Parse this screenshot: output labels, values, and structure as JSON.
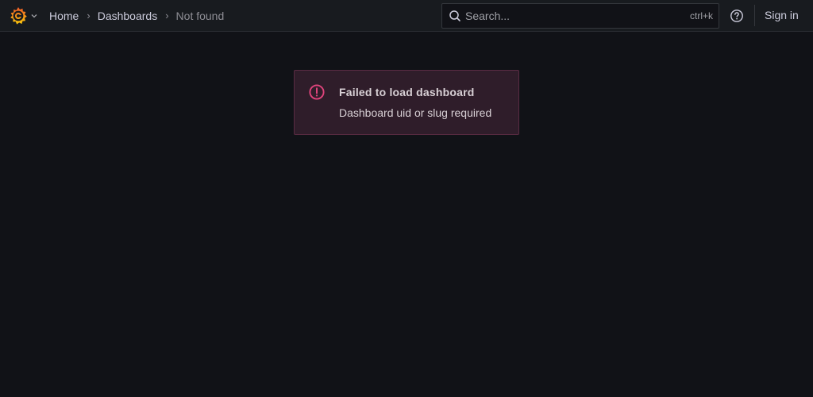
{
  "topbar": {
    "logo_icon": "grafana-logo-icon",
    "menu_chevron_icon": "chevron-down-icon",
    "breadcrumb": {
      "home": "Home",
      "dashboards": "Dashboards",
      "current": "Not found",
      "separator": "›"
    },
    "search": {
      "icon": "search-icon",
      "placeholder": "Search...",
      "shortcut": "ctrl+k"
    },
    "help_icon": "help-circle-icon",
    "sign_in": "Sign in"
  },
  "alert": {
    "icon": "exclamation-circle-icon",
    "title": "Failed to load dashboard",
    "message": "Dashboard uid or slug required"
  },
  "colors": {
    "background": "#111217",
    "topbar": "#181b1f",
    "alert_bg": "#2f1d2a",
    "alert_border": "#5a2b43",
    "error_accent": "#e0447c",
    "logo_orange": "#f05a28",
    "logo_yellow": "#fbca0a"
  }
}
